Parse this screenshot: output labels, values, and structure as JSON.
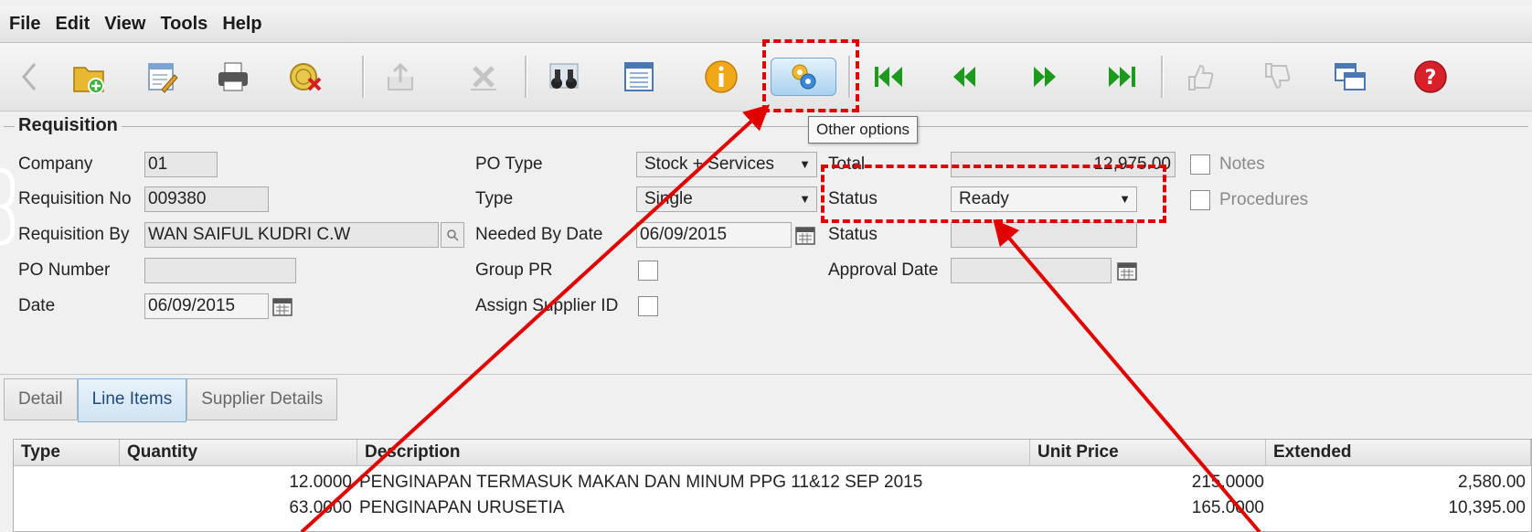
{
  "menu": [
    "File",
    "Edit",
    "View",
    "Tools",
    "Help"
  ],
  "toolbar": {
    "buttons": [
      {
        "name": "back-arrow-icon",
        "enabled": false
      },
      {
        "name": "new-folder-icon",
        "enabled": true
      },
      {
        "name": "edit-form-icon",
        "enabled": true
      },
      {
        "name": "printer-icon",
        "enabled": true
      },
      {
        "name": "cancel-coins-icon",
        "enabled": true
      },
      {
        "name": "export-icon",
        "enabled": false
      },
      {
        "name": "delete-x-icon",
        "enabled": false
      },
      {
        "name": "binoculars-icon",
        "enabled": true
      },
      {
        "name": "list-view-icon",
        "enabled": true
      },
      {
        "name": "info-icon",
        "enabled": true
      },
      {
        "name": "other-options-icon",
        "enabled": true
      },
      {
        "name": "first-record-icon",
        "enabled": true
      },
      {
        "name": "previous-record-icon",
        "enabled": true
      },
      {
        "name": "next-record-icon",
        "enabled": true
      },
      {
        "name": "last-record-icon",
        "enabled": true
      },
      {
        "name": "approve-hand-icon",
        "enabled": false
      },
      {
        "name": "reject-hand-icon",
        "enabled": false
      },
      {
        "name": "windows-icon",
        "enabled": true
      },
      {
        "name": "help-icon",
        "enabled": true
      }
    ],
    "tooltip": "Other options"
  },
  "requisition": {
    "title": "Requisition",
    "company_label": "Company",
    "company": "01",
    "req_no_label": "Requisition No",
    "req_no": "009380",
    "req_by_label": "Requisition By",
    "req_by": "WAN SAIFUL KUDRI C.W",
    "po_number_label": "PO Number",
    "po_number": "",
    "date_label": "Date",
    "date": "06/09/2015",
    "po_type_label": "PO Type",
    "po_type": "Stock + Services",
    "type_label": "Type",
    "type": "Single",
    "needed_by_label": "Needed By Date",
    "needed_by": "06/09/2015",
    "group_pr_label": "Group PR",
    "assign_supplier_label": "Assign Supplier ID",
    "total_label": "Total",
    "total": "12,975.00",
    "status_label": "Status",
    "status": "Ready",
    "status2_label": "Status",
    "status2": "",
    "approval_label": "Approval Date",
    "approval": "",
    "notes_label": "Notes",
    "procedures_label": "Procedures"
  },
  "tabs": [
    {
      "label": "Detail",
      "active": false
    },
    {
      "label": "Line Items",
      "active": true
    },
    {
      "label": "Supplier Details",
      "active": false
    }
  ],
  "grid": {
    "headers": [
      "Type",
      "Quantity",
      "Description",
      "Unit Price",
      "Extended"
    ],
    "rows": [
      {
        "type": "",
        "quantity": "12.0000",
        "description": "PENGINAPAN TERMASUK MAKAN DAN MINUM PPG 11&12 SEP 2015",
        "unit_price": "215.0000",
        "extended": "2,580.00"
      },
      {
        "type": "",
        "quantity": "63.0000",
        "description": "PENGINAPAN URUSETIA",
        "unit_price": "165.0000",
        "extended": "10,395.00"
      }
    ]
  },
  "colors": {
    "callout": "#e00000",
    "nav_green": "#1c9a1c",
    "tab_active": "#cfe3f3"
  }
}
